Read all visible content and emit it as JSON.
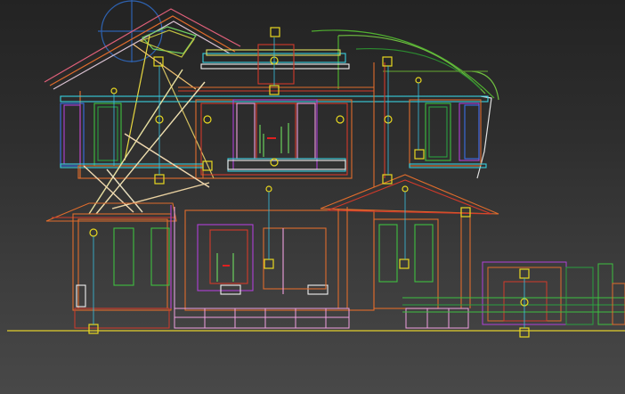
{
  "viewport": {
    "label": "",
    "background_top": "#232323",
    "background_bottom": "#484848",
    "object": "house-wireframe-elevation"
  },
  "colors": {
    "roof": "#e0607a",
    "orange": "#e06c2c",
    "red": "#d23a2a",
    "cyan": "#38d0e0",
    "yellow": "#e8d820",
    "green": "#3ec040",
    "purple": "#b040d8",
    "blue": "#3a6ee8",
    "pink": "#f0a0e0",
    "white": "#f0f0f0",
    "ground": "#c8b830"
  },
  "helpers": {
    "light_icon": "sun-light-icon",
    "gizmo_icon": "square-helper-icon"
  }
}
